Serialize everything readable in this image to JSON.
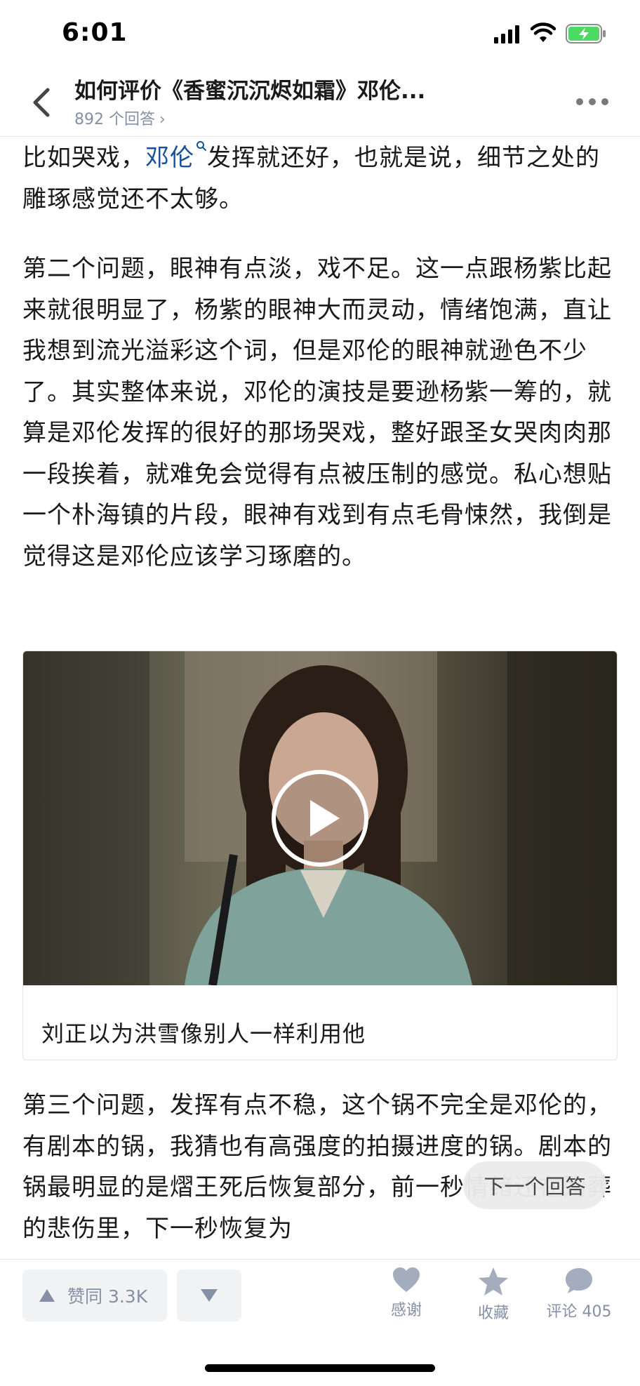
{
  "status_bar": {
    "time": "6:01"
  },
  "header": {
    "title": "如何评价《香蜜沉沉烬如霜》邓伦...",
    "answer_count": "892 个回答",
    "chevron": "›"
  },
  "article": {
    "p1_before": "比如哭戏，",
    "p1_link": "邓伦",
    "p1_after": "发挥就还好，也就是说，细节之处的雕琢感觉还不太够。",
    "p2": "第二个问题，眼神有点淡，戏不足。这一点跟杨紫比起来就很明显了，杨紫的眼神大而灵动，情绪饱满，直让我想到流光溢彩这个词，但是邓伦的眼神就逊色不少了。其实整体来说，邓伦的演技是要逊杨紫一筹的，就算是邓伦发挥的很好的那场哭戏，整好跟圣女哭肉肉那一段挨着，就难免会觉得有点被压制的感觉。私心想贴一个朴海镇的片段，眼神有戏到有点毛骨悚然，我倒是觉得这是邓伦应该学习琢磨的。",
    "video_caption": "刘正以为洪雪像别人一样利用他",
    "p3": "第三个问题，发挥有点不稳，这个锅不完全是邓伦的，有剧本的锅，我猜也有高强度的拍摄进度的锅。剧本的锅最明显的是熠王死后恢复部分，前一秒情绪还在殉葬的悲伤里，下一秒恢复为"
  },
  "next_answer_label": "下一个回答",
  "bottom_bar": {
    "upvote_label": "赞同 3.3K",
    "thanks_label": "感谢",
    "favorite_label": "收藏",
    "comment_label": "评论 405"
  },
  "icons": {
    "back": "chevron-left-icon",
    "more": "more-dots-icon",
    "play": "play-icon",
    "thanks": "heart-icon",
    "favorite": "star-icon",
    "comment": "comment-bubble-icon"
  },
  "colors": {
    "link": "#175199",
    "meta_gray": "#8590a6",
    "battery_green": "#4cd964"
  }
}
